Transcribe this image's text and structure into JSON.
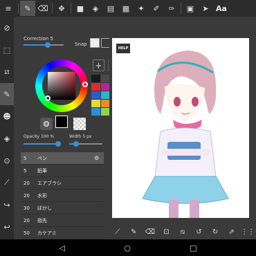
{
  "topbar": {
    "tools": [
      {
        "icon": "pen-icon",
        "glyph": "✎",
        "active": true
      },
      {
        "icon": "eraser-icon",
        "glyph": "⌫",
        "active": false
      },
      {
        "icon": "move-icon",
        "glyph": "✥",
        "active": false
      },
      {
        "icon": "fill-shape-icon",
        "glyph": "■",
        "active": false
      },
      {
        "icon": "bucket-icon",
        "glyph": "◈",
        "active": false
      },
      {
        "icon": "gradient-icon",
        "glyph": "▤",
        "active": false
      },
      {
        "icon": "select-icon",
        "glyph": "▦",
        "active": false
      },
      {
        "icon": "wand-icon",
        "glyph": "✦",
        "active": false
      },
      {
        "icon": "select-pen-icon",
        "glyph": "✐",
        "active": false
      },
      {
        "icon": "select-eraser-icon",
        "glyph": "✑",
        "active": false
      },
      {
        "icon": "frame-icon",
        "glyph": "▣",
        "active": false
      },
      {
        "icon": "cursor-icon",
        "glyph": "➤",
        "active": false
      }
    ],
    "text_tool": "Aa"
  },
  "leftcol": {
    "tools": [
      {
        "icon": "edit-icon",
        "glyph": "⊘",
        "active": false
      },
      {
        "icon": "marquee-icon",
        "glyph": "⬚",
        "active": false
      },
      {
        "icon": "transform-icon",
        "glyph": "⧄",
        "active": false
      },
      {
        "icon": "brush-panel-icon",
        "glyph": "✎",
        "active": true
      },
      {
        "icon": "color-panel-icon",
        "glyph": "☻",
        "active": false
      },
      {
        "icon": "layer-panel-icon",
        "glyph": "◈",
        "active": false
      },
      {
        "icon": "material-icon",
        "glyph": "⊙",
        "active": false
      },
      {
        "icon": "eyedropper-icon",
        "glyph": "⟋",
        "active": false
      },
      {
        "icon": "share-icon",
        "glyph": "↪",
        "active": false
      },
      {
        "icon": "undo-icon",
        "glyph": "↩",
        "active": false
      }
    ]
  },
  "panel": {
    "correction_label": "Correction 5",
    "correction_value": 0.6,
    "snap_label": "Snap",
    "snap_modes": [
      true,
      false,
      false,
      false,
      false,
      false
    ],
    "opacity_label": "Opacity 100 %",
    "opacity_value": 1.0,
    "width_label": "Width 5 px",
    "width_value": 0.2,
    "swatch_colors": [
      "#1a1a1a",
      "#4a4a4a",
      "#6d6d6d",
      "#e02a2a",
      "#b02898",
      "#7a2cc0",
      "#2a5ad8",
      "#28b8c8",
      "#2ab84a",
      "#e8d828",
      "#f08828",
      "#e83a8a",
      "#2a90d8",
      "#88d848",
      "#bcbcbc"
    ],
    "fg_color": "#000000",
    "brushes": [
      {
        "size": "5",
        "name": "ペン",
        "selected": true
      },
      {
        "size": "5",
        "name": "鉛筆",
        "selected": false
      },
      {
        "size": "20",
        "name": "エアブラシ",
        "selected": false
      },
      {
        "size": "20",
        "name": "水彩",
        "selected": false
      },
      {
        "size": "30",
        "name": "ぼかし",
        "selected": false
      },
      {
        "size": "20",
        "name": "指先",
        "selected": false
      },
      {
        "size": "50",
        "name": "カケアミ",
        "selected": false
      }
    ],
    "side_buttons": [
      {
        "icon": "add-brush-icon",
        "glyph": "+"
      },
      {
        "icon": "delete-brush-icon",
        "glyph": "🗑"
      },
      {
        "icon": "move-up-icon",
        "glyph": "⌃"
      },
      {
        "icon": "move-down-icon",
        "glyph": "⌄"
      }
    ]
  },
  "canvas": {
    "help_label": "HELP"
  },
  "bottombar": {
    "tools": [
      {
        "icon": "eyedropper-icon",
        "glyph": "⟋"
      },
      {
        "icon": "pen-icon",
        "glyph": "✎"
      },
      {
        "icon": "eraser-icon",
        "glyph": "⌫"
      },
      {
        "icon": "save-icon",
        "glyph": "⊡"
      },
      {
        "icon": "layer-clear-icon",
        "glyph": "⧅"
      },
      {
        "icon": "undo-icon",
        "glyph": "↺"
      },
      {
        "icon": "redo-icon",
        "glyph": "↻"
      },
      {
        "icon": "export-icon",
        "glyph": "⇗"
      },
      {
        "icon": "grid-menu-icon",
        "glyph": "⋮⋮"
      }
    ]
  },
  "navbar": {
    "back_glyph": "◁",
    "home_glyph": "○",
    "recent_glyph": "□"
  }
}
